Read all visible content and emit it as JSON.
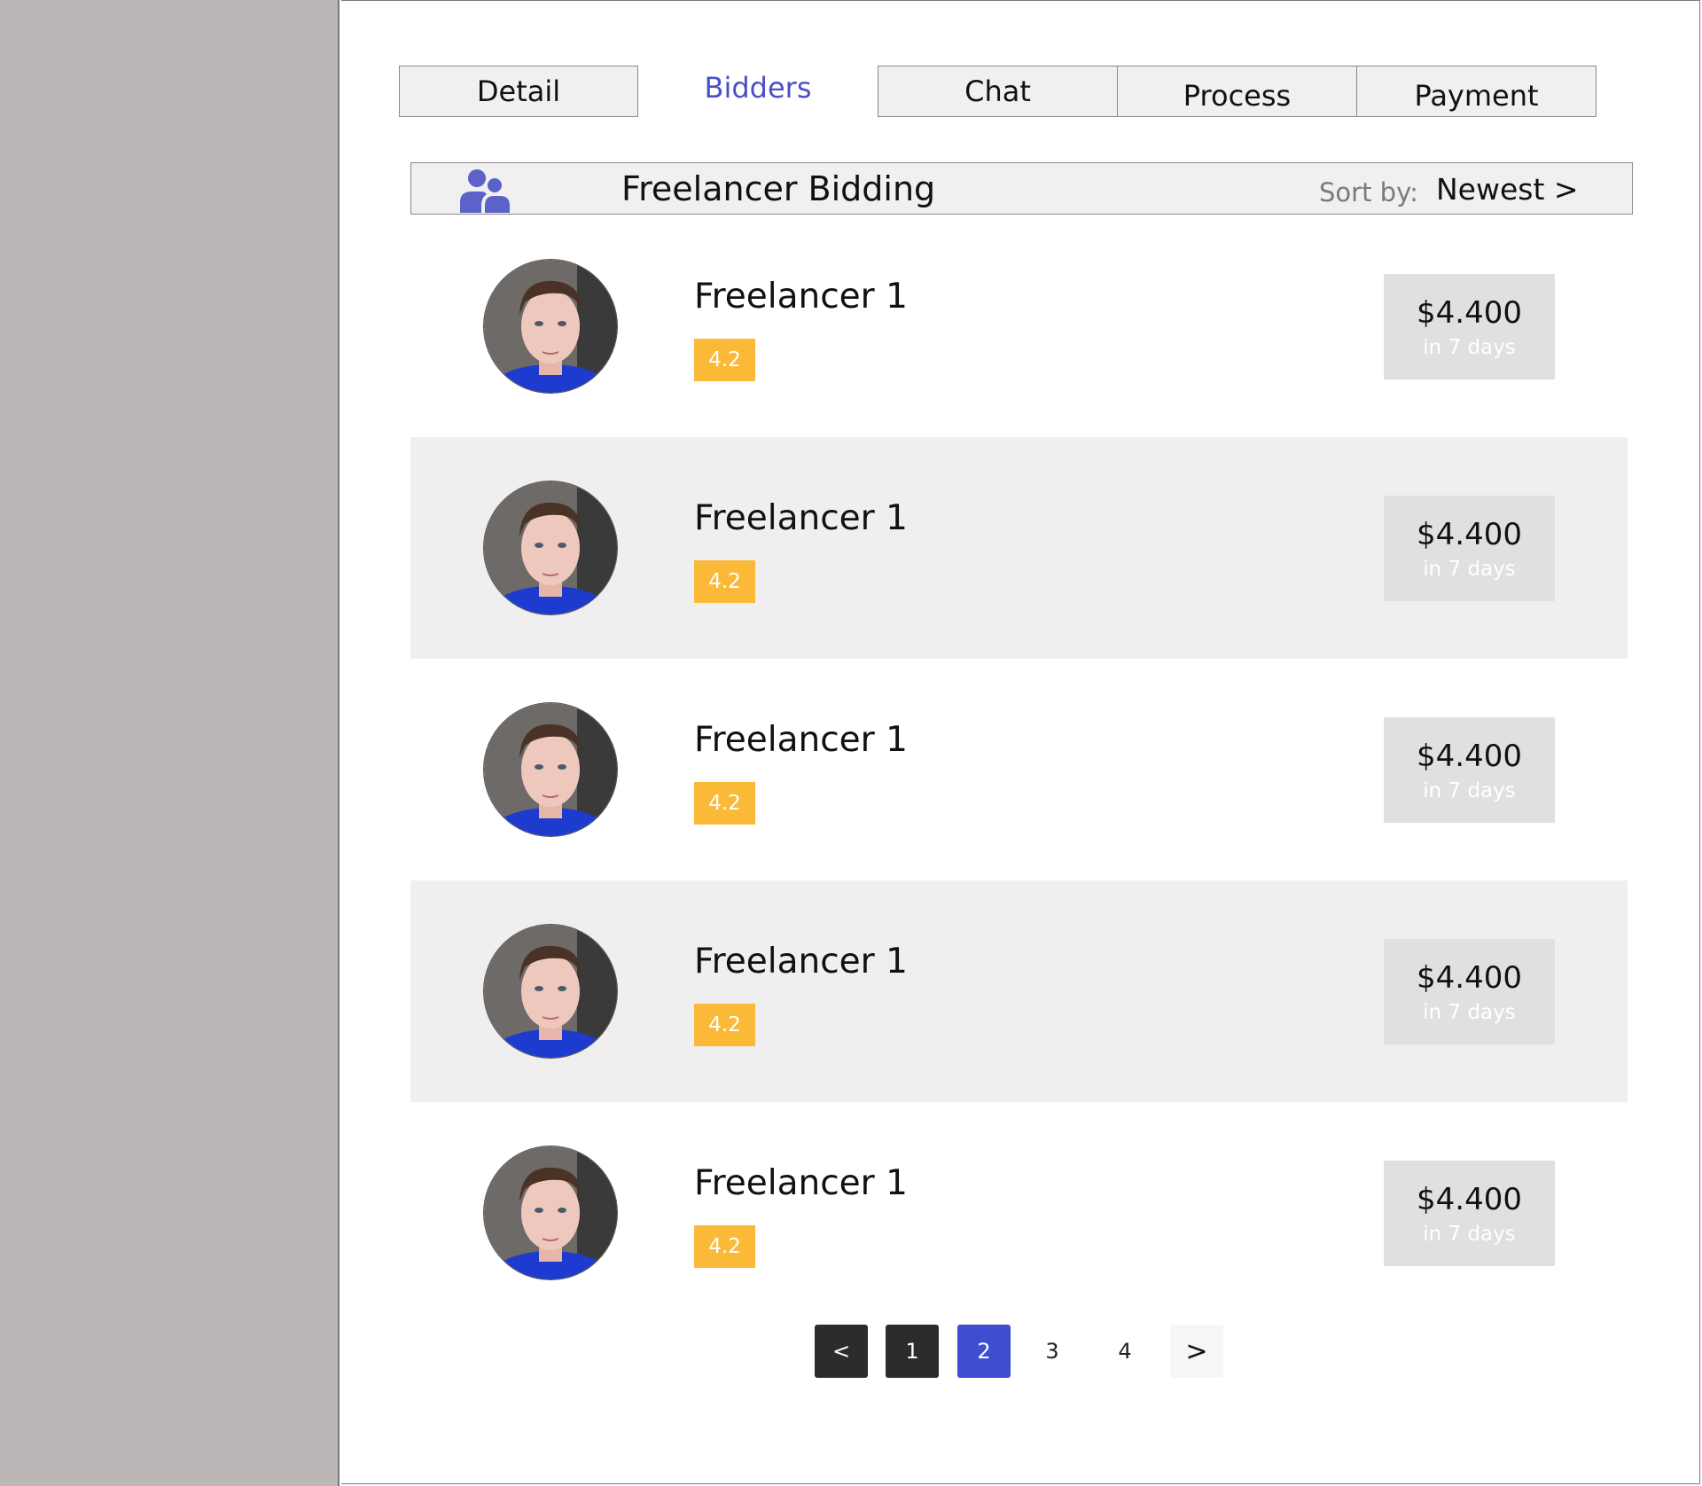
{
  "tabs": [
    {
      "label": "Detail",
      "active": false
    },
    {
      "label": "Bidders",
      "active": true
    },
    {
      "label": "Chat",
      "active": false
    },
    {
      "label": "Process",
      "active": false
    },
    {
      "label": "Payment",
      "active": false
    }
  ],
  "bidding": {
    "icon": "users-icon",
    "title": "Freelancer Bidding",
    "sort_label": "Sort by:",
    "sort_value": "Newest >"
  },
  "bidders": [
    {
      "name": "Freelancer 1",
      "rating": "4.2",
      "amount": "$4.400",
      "duration": "in 7 days"
    },
    {
      "name": "Freelancer 1",
      "rating": "4.2",
      "amount": "$4.400",
      "duration": "in 7 days"
    },
    {
      "name": "Freelancer 1",
      "rating": "4.2",
      "amount": "$4.400",
      "duration": "in 7 days"
    },
    {
      "name": "Freelancer 1",
      "rating": "4.2",
      "amount": "$4.400",
      "duration": "in 7 days"
    },
    {
      "name": "Freelancer 1",
      "rating": "4.2",
      "amount": "$4.400",
      "duration": "in 7 days"
    }
  ],
  "pagination": {
    "prev": "<",
    "pages": [
      "1",
      "2",
      "3",
      "4"
    ],
    "current": "2",
    "next": ">"
  },
  "colors": {
    "accent": "#4b50c8",
    "rating_badge": "#fbb938",
    "current_page": "#3d4ed0",
    "sidebar": "#bcb7b7"
  }
}
